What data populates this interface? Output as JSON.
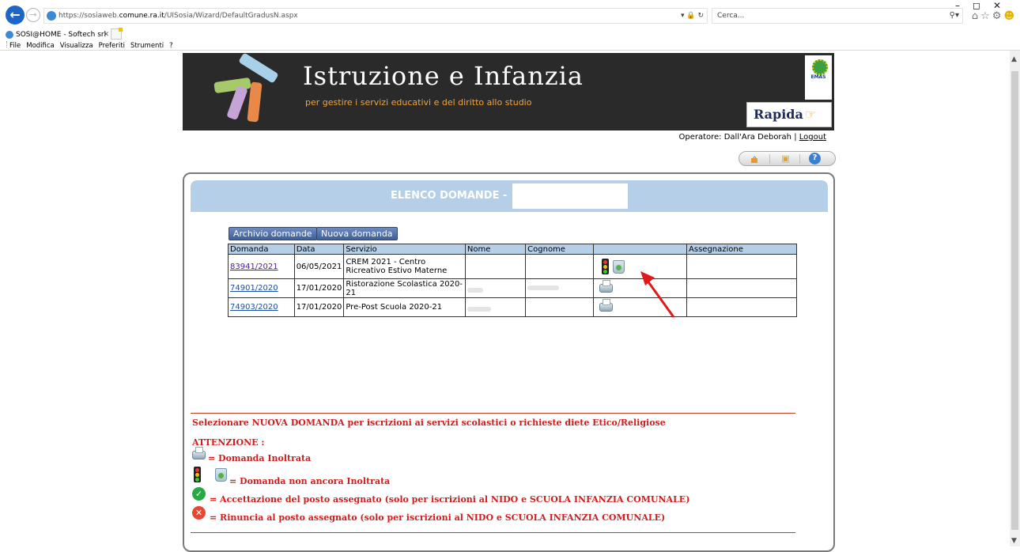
{
  "browser": {
    "url_prefix": "https://sosiaweb.",
    "url_domain": "comune.ra.it",
    "url_path": "/UISosia/Wizard/DefaultGradusN.aspx",
    "search_placeholder": "Cerca...",
    "tab_title": "SOSI@HOME - Softech srl",
    "menu": [
      "File",
      "Modifica",
      "Visualizza",
      "Preferiti",
      "Strumenti",
      "?"
    ]
  },
  "banner": {
    "title": "Istruzione e Infanzia",
    "subtitle": "per gestire i servizi educativi e del diritto allo studio",
    "emas": "EMAS",
    "rapida_1": "Rapida",
    "rapida_2": ""
  },
  "operator": {
    "prefix": "Operatore: Dall'Ara Deborah",
    "separator": " | ",
    "logout": "Logout"
  },
  "panel": {
    "title": "ELENCO DOMANDE - ",
    "buttons": {
      "archive": "Archivio domande",
      "new": "Nuova domanda"
    }
  },
  "table": {
    "headers": [
      "Domanda",
      "Data",
      "Servizio",
      "Nome",
      "Cognome",
      "",
      "Assegnazione"
    ],
    "rows": [
      {
        "domanda": "83941/2021",
        "data": "06/05/2021",
        "servizio": "CREM 2021 - Centro Ricreativo Estivo Materne",
        "status": "non-inoltrata"
      },
      {
        "domanda": "74901/2020",
        "data": "17/01/2020",
        "servizio": "Ristorazione Scolastica 2020-21",
        "status": "inoltrata"
      },
      {
        "domanda": "74903/2020",
        "data": "17/01/2020",
        "servizio": "Pre-Post Scuola 2020-21",
        "status": "inoltrata"
      }
    ]
  },
  "legend": {
    "intro": "Selezionare NUOVA DOMANDA per iscrizioni ai servizi scolastici o richieste diete Etico/Religiose",
    "attention": "ATTENZIONE :",
    "inoltrata": "= Domanda Inoltrata",
    "non_inoltrata": "= Domanda non ancora Inoltrata",
    "accettazione": "= Accettazione del posto assegnato (solo per iscrizioni al NIDO e SCUOLA INFANZIA COMUNALE)",
    "rinuncia": "= Rinuncia al posto assegnato (solo per iscrizioni al NIDO e SCUOLA INFANZIA COMUNALE)"
  },
  "colors": {
    "header_blue": "#b6cfe8",
    "legend_red": "#d11d1d",
    "button_blue": "#4f6ea8"
  },
  "icons": [
    "back-icon",
    "forward-icon",
    "home-icon",
    "folder-icon",
    "help-icon",
    "traffic-light-icon",
    "trash-icon",
    "printer-icon",
    "check-icon",
    "cancel-icon"
  ]
}
